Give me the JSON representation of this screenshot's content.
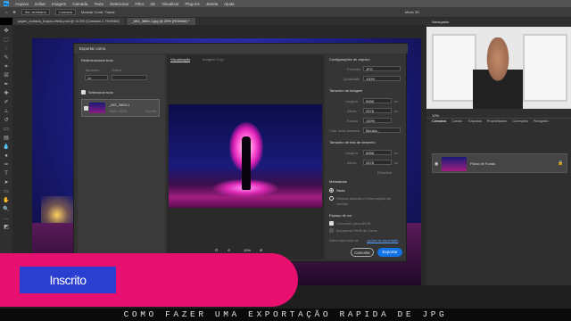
{
  "menubar": {
    "logo": "Ps",
    "items": [
      "Arquivo",
      "Editar",
      "Imagem",
      "Camada",
      "Texto",
      "Selecionar",
      "Filtro",
      "3D",
      "Visualizar",
      "Plug-ins",
      "Janela",
      "Ajuda"
    ]
  },
  "options": {
    "size_mode": "Sel. Arbitrário",
    "mode": "Camada",
    "extra": "Mostrar Contr. Transf.",
    "right_label": "Modo 3D"
  },
  "tabs": [
    {
      "label": "paper_cortado_trapos-efeito.psd @ 11,5% (Camada 2, RGB/8#)",
      "active": false
    },
    {
      "label": "_MG_3864-1.jpg @ 25% (RGB/8#) *",
      "active": true
    }
  ],
  "dialog": {
    "title": "Exportar como",
    "left": {
      "resize_all": "Redimensionar tudo",
      "size_label": "Tamanho",
      "suffix_label": "Sufixo",
      "size_value": "1x",
      "select_all": "Selecionar tudo",
      "item_name": "_MG_3864-1",
      "item_dims": "5068 × 3378",
      "item_size": "15,5 MB"
    },
    "center": {
      "tab_preview": "Visualização",
      "tab_2up": "Imagem 2-up",
      "zoom": "10%"
    },
    "right": {
      "file_settings": "Configurações de arquivo",
      "format_label": "Formato",
      "format_value": "JPG",
      "quality_label": "Qualidade",
      "quality_value": "100%",
      "image_size": "Tamanho da imagem",
      "width_label": "Largura",
      "width_value": "5068",
      "height_label": "Altura",
      "height_value": "3378",
      "scale_label": "Escala",
      "scale_value": "100%",
      "resample_label": "Criar nova amostra",
      "resample_value": "Bicúbic...",
      "unit": "px",
      "canvas_size": "Tamanho de tela de desenho",
      "cwidth_value": "5068",
      "cheight_value": "3378",
      "reset": "Redefinir",
      "metadata": "Metadados",
      "meta_none": "Nada",
      "meta_copy": "Direitos autorais e Informações de contato",
      "color_space": "Espaço de cor",
      "srgb": "Converter para sRGB",
      "embed": "Incorporar Perfil de Cores",
      "learn": "Saiba mais sobre as",
      "learn_link": "opções de exportação",
      "cancel": "Cancelar",
      "export": "Exportar"
    }
  },
  "panels": {
    "browser_tab": "Navegador",
    "zoom": "10%",
    "layers_tabs": [
      "Camadas",
      "Canais",
      "Traçados",
      "Propriedades",
      "Correções",
      "Parágrafo"
    ],
    "layer_name": "Plano de Fundo"
  },
  "overlay": {
    "subscribe": "Inscrito",
    "caption": "COMO FAZER UMA EXPORTAÇÃO RAPIDA DE JPG"
  },
  "colors": {
    "accent_blue": "#1473e6",
    "pink": "#e8106f",
    "subscribe_blue": "#2a3fd0"
  }
}
